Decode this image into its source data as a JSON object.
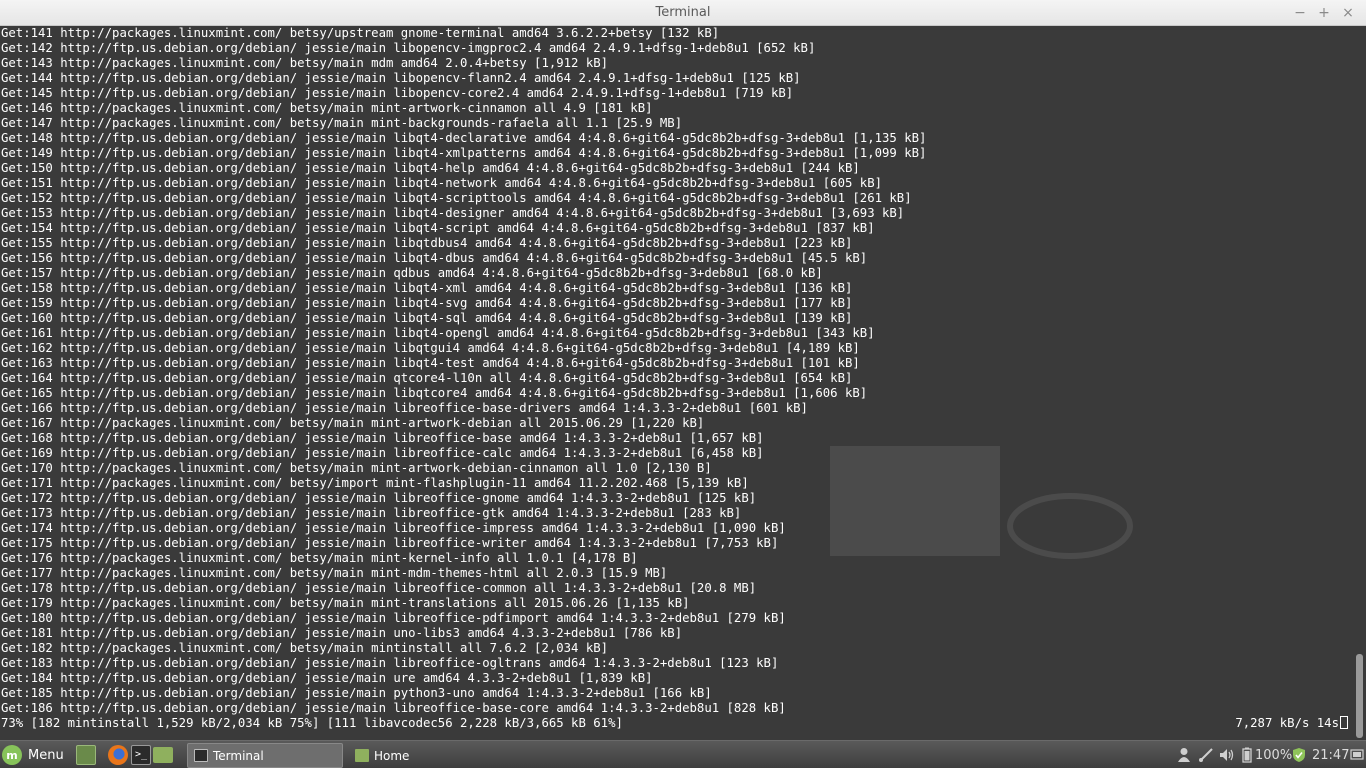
{
  "window": {
    "title": "Terminal",
    "min_glyph": "−",
    "max_glyph": "+",
    "close_glyph": "×"
  },
  "terminal": {
    "lines": [
      "Get:141 http://packages.linuxmint.com/ betsy/upstream gnome-terminal amd64 3.6.2.2+betsy [132 kB]",
      "Get:142 http://ftp.us.debian.org/debian/ jessie/main libopencv-imgproc2.4 amd64 2.4.9.1+dfsg-1+deb8u1 [652 kB]",
      "Get:143 http://packages.linuxmint.com/ betsy/main mdm amd64 2.0.4+betsy [1,912 kB]",
      "Get:144 http://ftp.us.debian.org/debian/ jessie/main libopencv-flann2.4 amd64 2.4.9.1+dfsg-1+deb8u1 [125 kB]",
      "Get:145 http://ftp.us.debian.org/debian/ jessie/main libopencv-core2.4 amd64 2.4.9.1+dfsg-1+deb8u1 [719 kB]",
      "Get:146 http://packages.linuxmint.com/ betsy/main mint-artwork-cinnamon all 4.9 [181 kB]",
      "Get:147 http://packages.linuxmint.com/ betsy/main mint-backgrounds-rafaela all 1.1 [25.9 MB]",
      "Get:148 http://ftp.us.debian.org/debian/ jessie/main libqt4-declarative amd64 4:4.8.6+git64-g5dc8b2b+dfsg-3+deb8u1 [1,135 kB]",
      "Get:149 http://ftp.us.debian.org/debian/ jessie/main libqt4-xmlpatterns amd64 4:4.8.6+git64-g5dc8b2b+dfsg-3+deb8u1 [1,099 kB]",
      "Get:150 http://ftp.us.debian.org/debian/ jessie/main libqt4-help amd64 4:4.8.6+git64-g5dc8b2b+dfsg-3+deb8u1 [244 kB]",
      "Get:151 http://ftp.us.debian.org/debian/ jessie/main libqt4-network amd64 4:4.8.6+git64-g5dc8b2b+dfsg-3+deb8u1 [605 kB]",
      "Get:152 http://ftp.us.debian.org/debian/ jessie/main libqt4-scripttools amd64 4:4.8.6+git64-g5dc8b2b+dfsg-3+deb8u1 [261 kB]",
      "Get:153 http://ftp.us.debian.org/debian/ jessie/main libqt4-designer amd64 4:4.8.6+git64-g5dc8b2b+dfsg-3+deb8u1 [3,693 kB]",
      "Get:154 http://ftp.us.debian.org/debian/ jessie/main libqt4-script amd64 4:4.8.6+git64-g5dc8b2b+dfsg-3+deb8u1 [837 kB]",
      "Get:155 http://ftp.us.debian.org/debian/ jessie/main libqtdbus4 amd64 4:4.8.6+git64-g5dc8b2b+dfsg-3+deb8u1 [223 kB]",
      "Get:156 http://ftp.us.debian.org/debian/ jessie/main libqt4-dbus amd64 4:4.8.6+git64-g5dc8b2b+dfsg-3+deb8u1 [45.5 kB]",
      "Get:157 http://ftp.us.debian.org/debian/ jessie/main qdbus amd64 4:4.8.6+git64-g5dc8b2b+dfsg-3+deb8u1 [68.0 kB]",
      "Get:158 http://ftp.us.debian.org/debian/ jessie/main libqt4-xml amd64 4:4.8.6+git64-g5dc8b2b+dfsg-3+deb8u1 [136 kB]",
      "Get:159 http://ftp.us.debian.org/debian/ jessie/main libqt4-svg amd64 4:4.8.6+git64-g5dc8b2b+dfsg-3+deb8u1 [177 kB]",
      "Get:160 http://ftp.us.debian.org/debian/ jessie/main libqt4-sql amd64 4:4.8.6+git64-g5dc8b2b+dfsg-3+deb8u1 [139 kB]",
      "Get:161 http://ftp.us.debian.org/debian/ jessie/main libqt4-opengl amd64 4:4.8.6+git64-g5dc8b2b+dfsg-3+deb8u1 [343 kB]",
      "Get:162 http://ftp.us.debian.org/debian/ jessie/main libqtgui4 amd64 4:4.8.6+git64-g5dc8b2b+dfsg-3+deb8u1 [4,189 kB]",
      "Get:163 http://ftp.us.debian.org/debian/ jessie/main libqt4-test amd64 4:4.8.6+git64-g5dc8b2b+dfsg-3+deb8u1 [101 kB]",
      "Get:164 http://ftp.us.debian.org/debian/ jessie/main qtcore4-l10n all 4:4.8.6+git64-g5dc8b2b+dfsg-3+deb8u1 [654 kB]",
      "Get:165 http://ftp.us.debian.org/debian/ jessie/main libqtcore4 amd64 4:4.8.6+git64-g5dc8b2b+dfsg-3+deb8u1 [1,606 kB]",
      "Get:166 http://ftp.us.debian.org/debian/ jessie/main libreoffice-base-drivers amd64 1:4.3.3-2+deb8u1 [601 kB]",
      "Get:167 http://packages.linuxmint.com/ betsy/main mint-artwork-debian all 2015.06.29 [1,220 kB]",
      "Get:168 http://ftp.us.debian.org/debian/ jessie/main libreoffice-base amd64 1:4.3.3-2+deb8u1 [1,657 kB]",
      "Get:169 http://ftp.us.debian.org/debian/ jessie/main libreoffice-calc amd64 1:4.3.3-2+deb8u1 [6,458 kB]",
      "Get:170 http://packages.linuxmint.com/ betsy/main mint-artwork-debian-cinnamon all 1.0 [2,130 B]",
      "Get:171 http://packages.linuxmint.com/ betsy/import mint-flashplugin-11 amd64 11.2.202.468 [5,139 kB]",
      "Get:172 http://ftp.us.debian.org/debian/ jessie/main libreoffice-gnome amd64 1:4.3.3-2+deb8u1 [125 kB]",
      "Get:173 http://ftp.us.debian.org/debian/ jessie/main libreoffice-gtk amd64 1:4.3.3-2+deb8u1 [283 kB]",
      "Get:174 http://ftp.us.debian.org/debian/ jessie/main libreoffice-impress amd64 1:4.3.3-2+deb8u1 [1,090 kB]",
      "Get:175 http://ftp.us.debian.org/debian/ jessie/main libreoffice-writer amd64 1:4.3.3-2+deb8u1 [7,753 kB]",
      "Get:176 http://packages.linuxmint.com/ betsy/main mint-kernel-info all 1.0.1 [4,178 B]",
      "Get:177 http://packages.linuxmint.com/ betsy/main mint-mdm-themes-html all 2.0.3 [15.9 MB]",
      "Get:178 http://ftp.us.debian.org/debian/ jessie/main libreoffice-common all 1:4.3.3-2+deb8u1 [20.8 MB]",
      "Get:179 http://packages.linuxmint.com/ betsy/main mint-translations all 2015.06.26 [1,135 kB]",
      "Get:180 http://ftp.us.debian.org/debian/ jessie/main libreoffice-pdfimport amd64 1:4.3.3-2+deb8u1 [279 kB]",
      "Get:181 http://ftp.us.debian.org/debian/ jessie/main uno-libs3 amd64 4.3.3-2+deb8u1 [786 kB]",
      "Get:182 http://packages.linuxmint.com/ betsy/main mintinstall all 7.6.2 [2,034 kB]",
      "Get:183 http://ftp.us.debian.org/debian/ jessie/main libreoffice-ogltrans amd64 1:4.3.3-2+deb8u1 [123 kB]",
      "Get:184 http://ftp.us.debian.org/debian/ jessie/main ure amd64 4.3.3-2+deb8u1 [1,839 kB]",
      "Get:185 http://ftp.us.debian.org/debian/ jessie/main python3-uno amd64 1:4.3.3-2+deb8u1 [166 kB]",
      "Get:186 http://ftp.us.debian.org/debian/ jessie/main libreoffice-base-core amd64 1:4.3.3-2+deb8u1 [828 kB]"
    ],
    "status_left": "73% [182 mintinstall 1,529 kB/2,034 kB 75%] [111 libavcodec56 2,228 kB/3,665 kB 61%]",
    "status_right": "7,287 kB/s 14s"
  },
  "taskbar": {
    "menu_label": "Menu",
    "launchers": [
      "show-desktop-icon",
      "firefox-icon",
      "terminal-icon",
      "files-icon"
    ],
    "tasks": [
      {
        "label": "Terminal",
        "icon": "terminal-icon",
        "active": true
      },
      {
        "label": "Home",
        "icon": "folder-icon",
        "active": false
      }
    ],
    "tray": {
      "battery": "100%",
      "clock": "21:47"
    }
  },
  "colors": {
    "terminal_bg": "#3a3a3a",
    "terminal_fg": "#ffffff",
    "mint_green": "#87c35a",
    "panel": "#4a4a4a"
  }
}
